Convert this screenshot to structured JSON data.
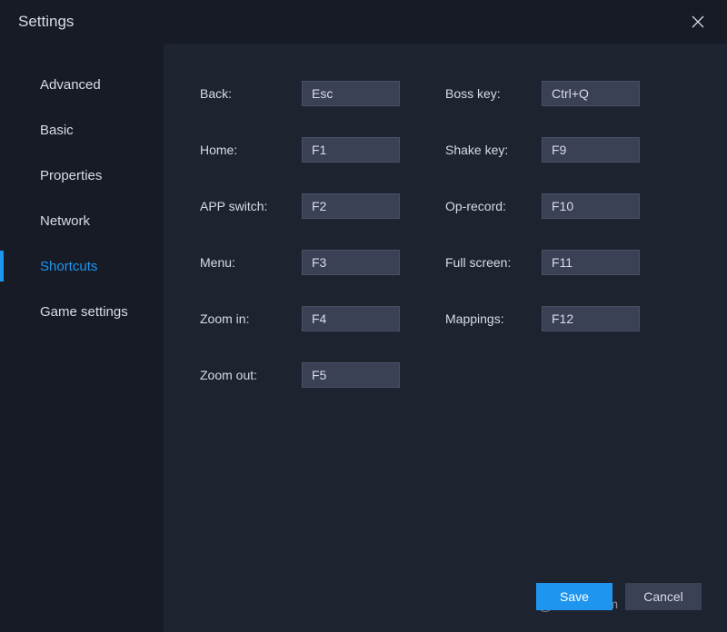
{
  "title": "Settings",
  "sidebar": {
    "items": [
      {
        "label": "Advanced",
        "active": false
      },
      {
        "label": "Basic",
        "active": false
      },
      {
        "label": "Properties",
        "active": false
      },
      {
        "label": "Network",
        "active": false
      },
      {
        "label": "Shortcuts",
        "active": true
      },
      {
        "label": "Game settings",
        "active": false
      }
    ]
  },
  "shortcuts": {
    "left": [
      {
        "label": "Back:",
        "value": "Esc"
      },
      {
        "label": "Home:",
        "value": "F1"
      },
      {
        "label": "APP switch:",
        "value": "F2"
      },
      {
        "label": "Menu:",
        "value": "F3"
      },
      {
        "label": "Zoom in:",
        "value": "F4"
      },
      {
        "label": "Zoom out:",
        "value": "F5"
      }
    ],
    "right": [
      {
        "label": "Boss key:",
        "value": "Ctrl+Q"
      },
      {
        "label": "Shake key:",
        "value": "F9"
      },
      {
        "label": "Op-record:",
        "value": "F10"
      },
      {
        "label": "Full screen:",
        "value": "F11"
      },
      {
        "label": "Mappings:",
        "value": "F12"
      }
    ]
  },
  "buttons": {
    "save": "Save",
    "cancel": "Cancel"
  },
  "watermark_text": "LO4D.com"
}
